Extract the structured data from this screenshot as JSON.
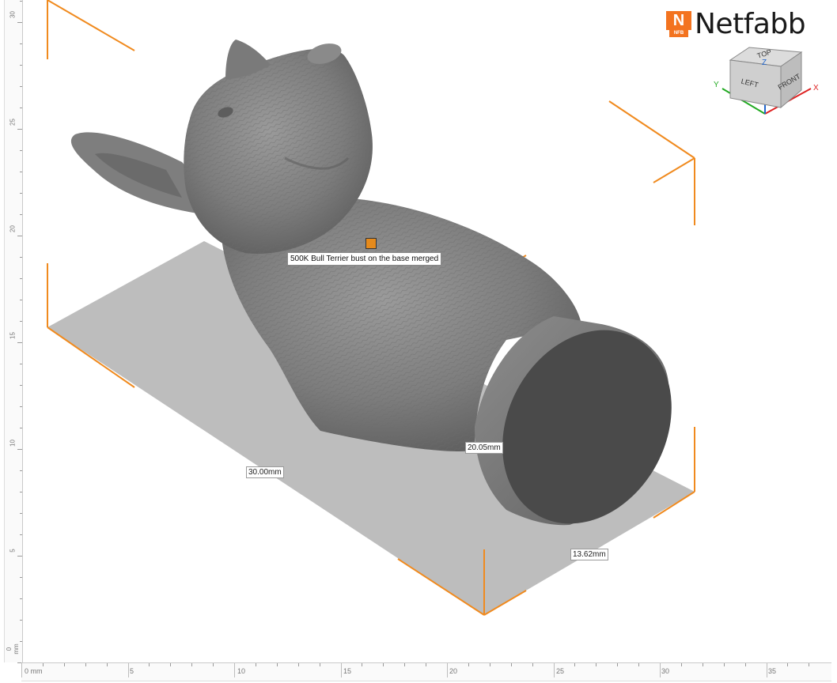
{
  "app": {
    "brand_name": "Netfabb",
    "brand_badge": "N",
    "brand_badge_sub": "NFB",
    "accent_color": "#f3731f"
  },
  "viewport": {
    "part_label": "500K Bull Terrier bust on the base merged",
    "dimensions": {
      "length": "30.00mm",
      "height": "20.05mm",
      "width": "13.62mm"
    },
    "bounding_box_color": "#f08a1e",
    "build_plate_color": "#bdbdbd",
    "model_color": "#7a7a7a"
  },
  "view_cube": {
    "faces": {
      "top": "TOP",
      "left": "LEFT",
      "front": "FRONT"
    },
    "axes": {
      "x": "X",
      "y": "Y",
      "z": "Z"
    }
  },
  "ruler_left": {
    "unit_label": "0 mm",
    "labels": [
      "5",
      "10",
      "15",
      "20",
      "25",
      "30"
    ]
  },
  "ruler_bottom": {
    "unit_label": "0 mm",
    "labels": [
      "5",
      "10",
      "15",
      "20",
      "25",
      "30",
      "35"
    ]
  }
}
